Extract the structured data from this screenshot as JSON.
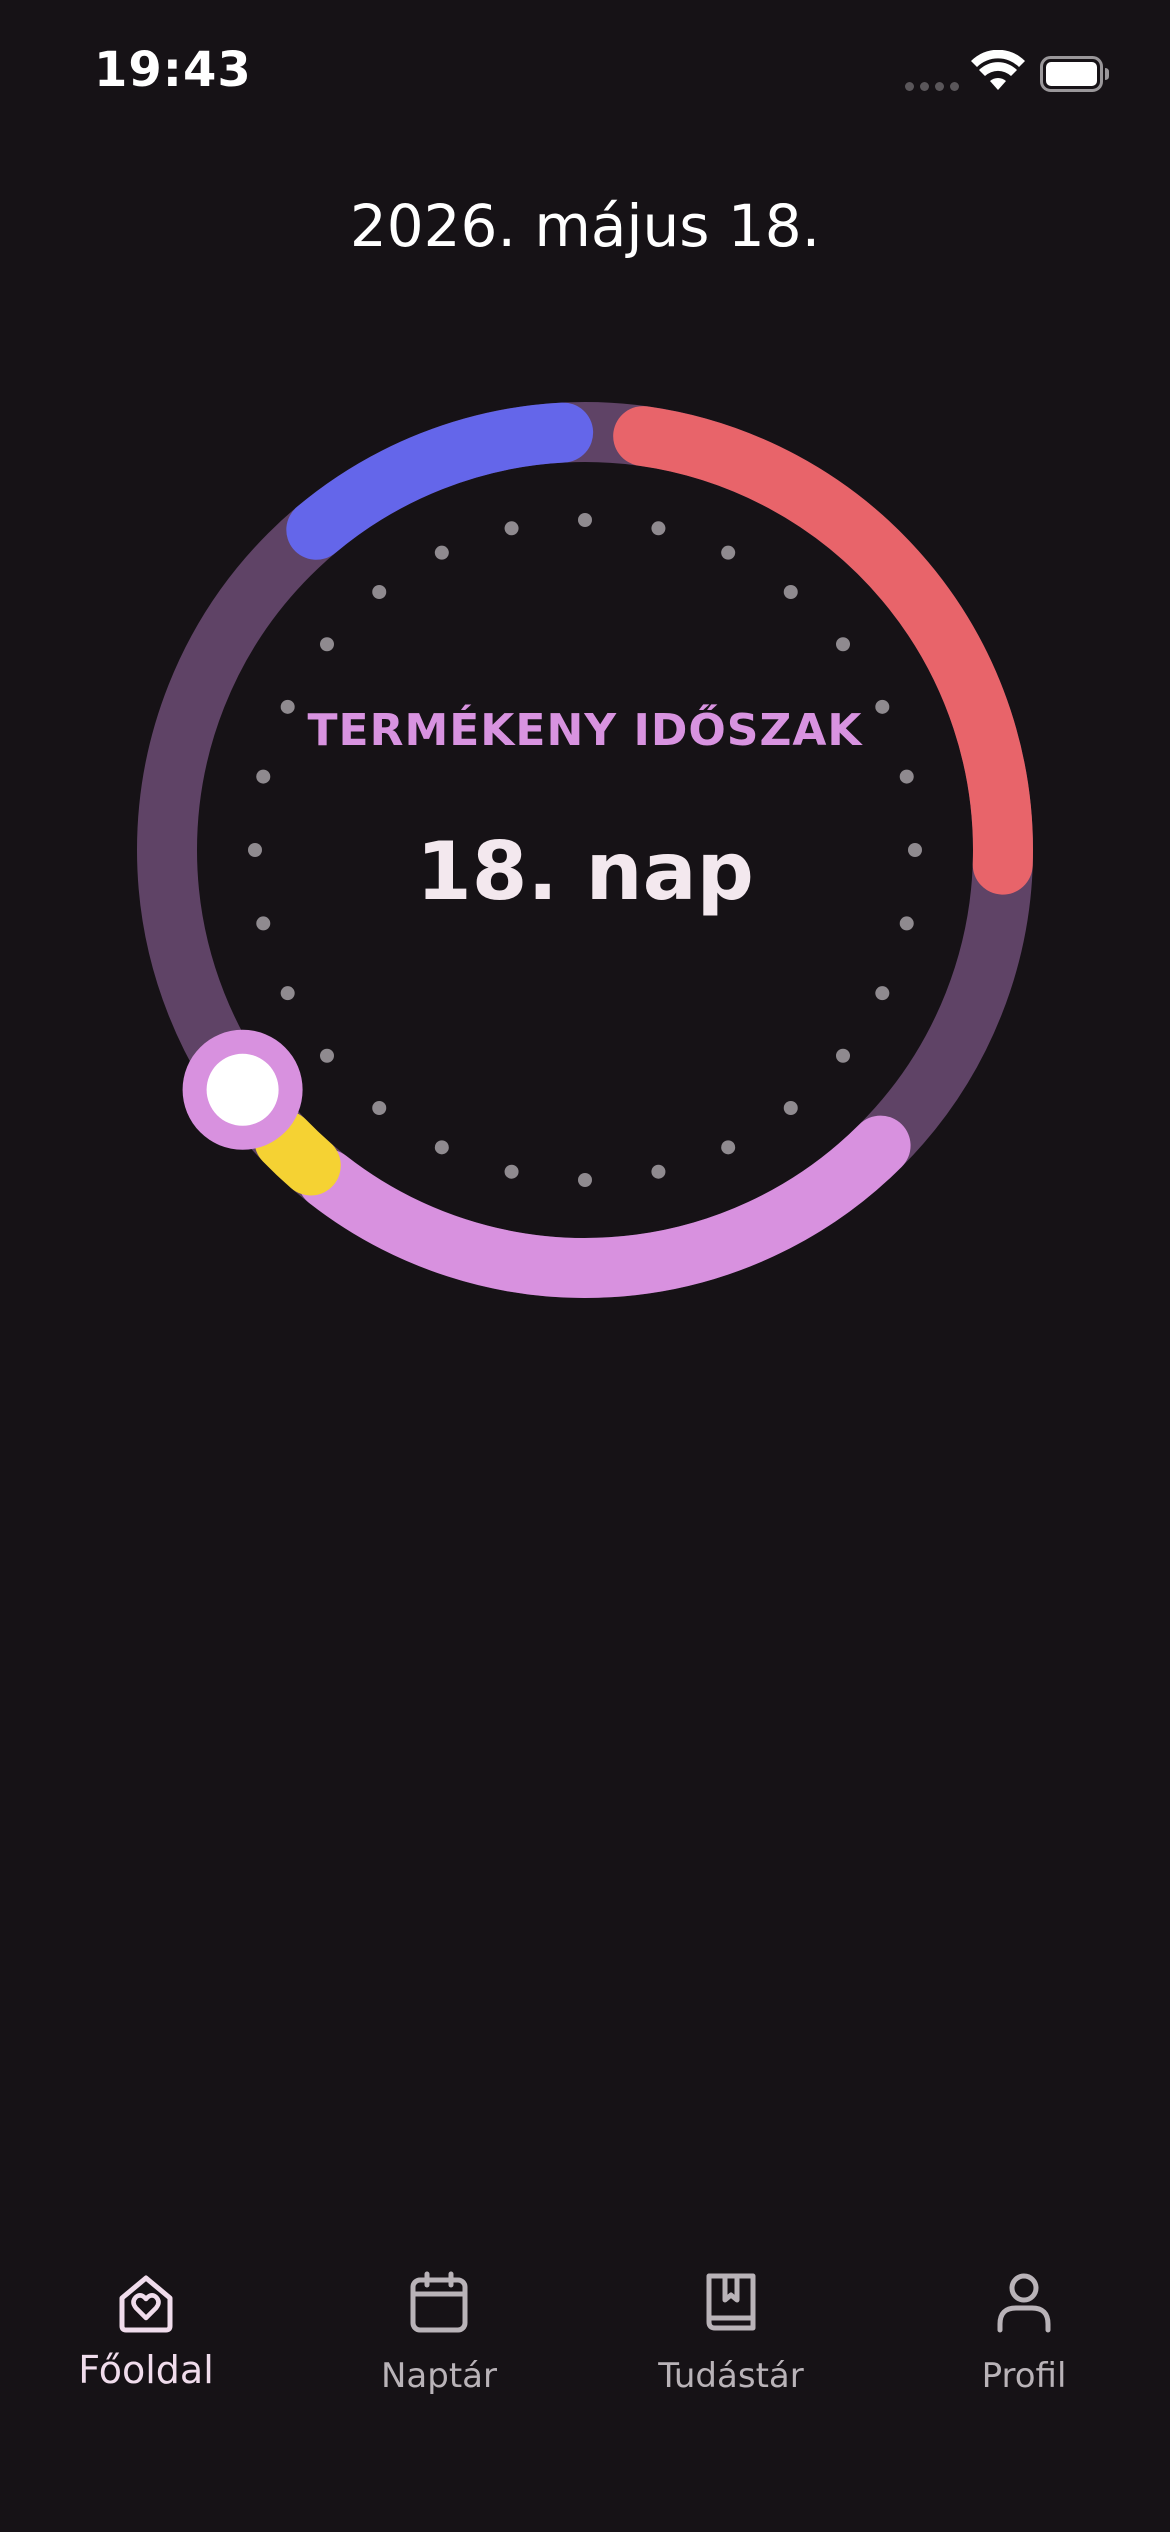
{
  "status_bar": {
    "time": "19:43"
  },
  "header": {
    "date": "2026. május 18."
  },
  "cycle": {
    "phase_label": "TERMÉKENY IDŐSZAK",
    "day_label": "18. nap",
    "colors": {
      "track": "#5f4366",
      "period": "#e8646a",
      "fertile": "#d891df",
      "ovulation": "#f5d233",
      "pms": "#6466ea",
      "marker_ring": "#d891df",
      "marker_fill": "#ffffff",
      "dots": "#8f8a8f"
    }
  },
  "nav": {
    "items": [
      {
        "label": "Főoldal",
        "icon": "home-heart-icon",
        "active": true
      },
      {
        "label": "Naptár",
        "icon": "calendar-icon",
        "active": false
      },
      {
        "label": "Tudástár",
        "icon": "book-bookmark-icon",
        "active": false
      },
      {
        "label": "Profil",
        "icon": "person-icon",
        "active": false
      }
    ],
    "active_color": "#f0dcec",
    "inactive_color": "#b9b3b8"
  }
}
